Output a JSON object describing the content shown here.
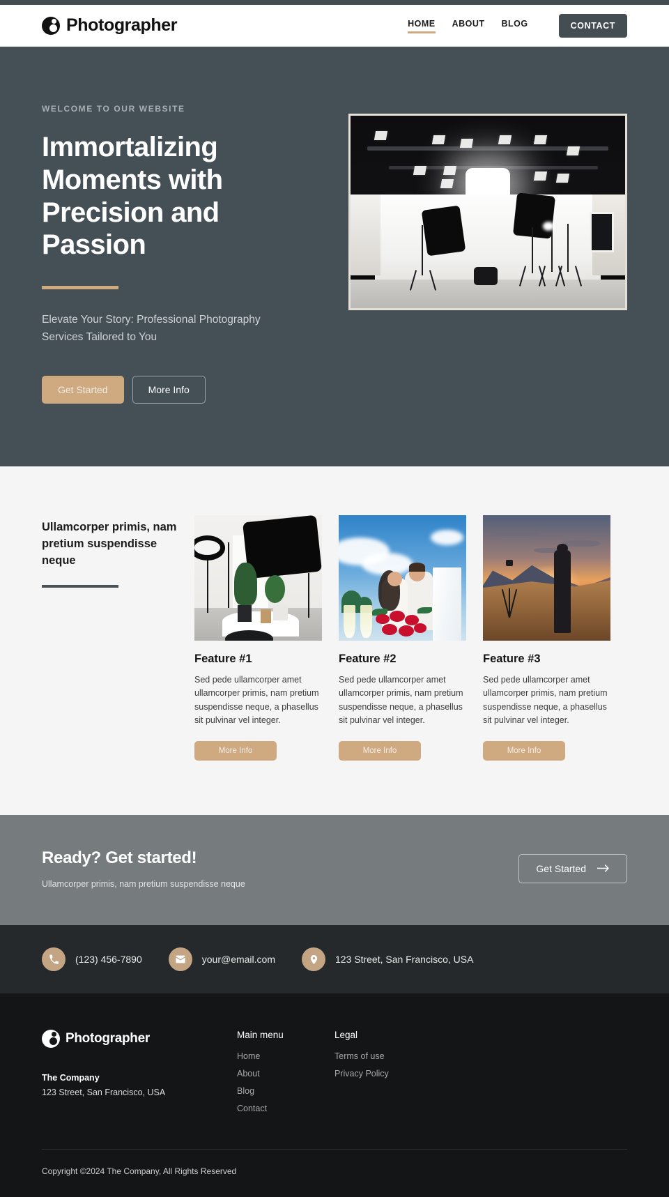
{
  "header": {
    "brand": "Photographer",
    "brand_icon": "aperture-circle-logo",
    "nav": [
      {
        "label": "HOME",
        "active": true
      },
      {
        "label": "ABOUT",
        "active": false
      },
      {
        "label": "BLOG",
        "active": false
      }
    ],
    "cta_label": "CONTACT"
  },
  "hero": {
    "eyebrow": "WELCOME TO OUR WEBSITE",
    "title": "Immortalizing Moments with Precision and Passion",
    "subtitle": "Elevate Your Story: Professional Photography Services Tailored to You",
    "primary_button": "Get Started",
    "secondary_button": "More Info",
    "image_alt": "photography-studio-with-lights"
  },
  "features": {
    "heading": "Ullamcorper primis, nam pretium suspendisse neque",
    "cards": [
      {
        "title": "Feature #1",
        "text": "Sed pede ullamcorper amet ullamcorper primis, nam pretium suspendisse neque, a phasellus sit pulvinar vel integer.",
        "button": "More Info",
        "image_alt": "studio-setup-with-plants"
      },
      {
        "title": "Feature #2",
        "text": "Sed pede ullamcorper amet ullamcorper primis, nam pretium suspendisse neque, a phasellus sit pulvinar vel integer.",
        "button": "More Info",
        "image_alt": "wedding-couple-with-roses"
      },
      {
        "title": "Feature #3",
        "text": "Sed pede ullamcorper amet ullamcorper primis, nam pretium suspendisse neque, a phasellus sit pulvinar vel integer.",
        "button": "More Info",
        "image_alt": "photographer-at-sunset-mountain"
      }
    ]
  },
  "cta": {
    "title": "Ready? Get started!",
    "subtitle": "Ullamcorper primis, nam pretium suspendisse neque",
    "button": "Get Started",
    "button_icon": "arrow-right-icon"
  },
  "contact": {
    "items": [
      {
        "icon": "phone-icon",
        "text": "(123) 456-7890"
      },
      {
        "icon": "envelope-icon",
        "text": "your@email.com"
      },
      {
        "icon": "location-pin-icon",
        "text": "123 Street, San Francisco, USA"
      }
    ]
  },
  "footer": {
    "brand": "Photographer",
    "company_label": "The Company",
    "company_address": "123 Street, San Francisco, USA",
    "columns": [
      {
        "title": "Main menu",
        "links": [
          "Home",
          "About",
          "Blog",
          "Contact"
        ]
      },
      {
        "title": "Legal",
        "links": [
          "Terms of use",
          "Privacy Policy"
        ]
      }
    ],
    "copyright": "Copyright ©2024 The Company, All Rights Reserved"
  },
  "colors": {
    "accent": "#cfa97f",
    "hero_bg": "#454f56",
    "cta_bg": "#767c7e",
    "contact_bg": "#26292b",
    "footer_bg": "#131516",
    "features_bg": "#f5f5f5"
  }
}
